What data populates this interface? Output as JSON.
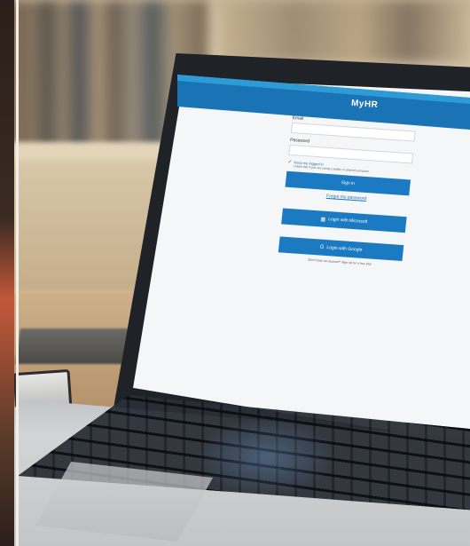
{
  "login": {
    "brand": "MyHR",
    "email_label": "Email",
    "password_label": "Password",
    "remember_label": "Keep me logged in",
    "remember_note": "Untick this if you are using a public or shared computer",
    "signin_label": "Sign in",
    "forgot_label": "Forgot my password",
    "microsoft_label": "Login with Microsoft",
    "google_label": "Login with Google",
    "note": "Don't have an account? Sign up for a free trial"
  },
  "colors": {
    "primary_blue": "#1c7ac2",
    "header_blue": "#1a73b4"
  },
  "icons": {
    "check": "check-icon",
    "microsoft": "microsoft-icon",
    "google": "google-icon"
  }
}
